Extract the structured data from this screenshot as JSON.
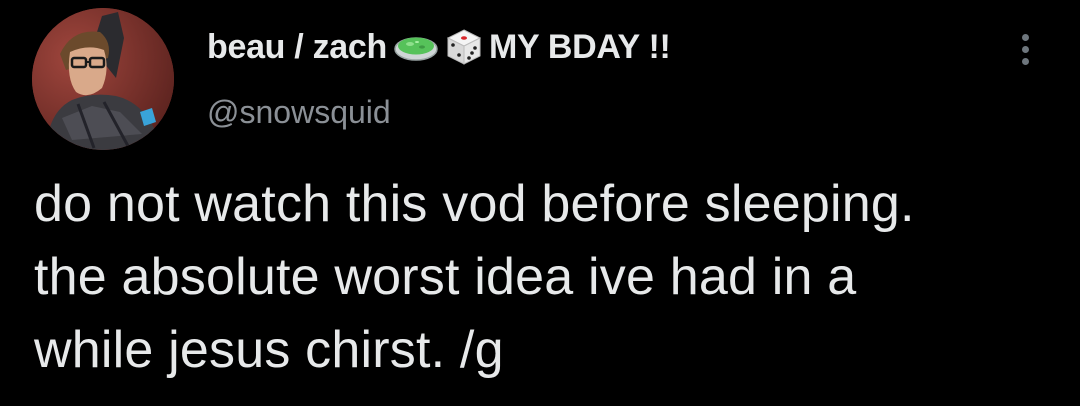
{
  "tweet": {
    "display_name": "beau / zach",
    "name_suffix": "MY BDAY !!",
    "name_emojis": [
      "petri-dish-icon",
      "dice-icon"
    ],
    "handle": "@snowsquid",
    "text": "do not watch this vod before sleeping.\nthe absolute worst idea ive had in a\nwhile jesus chirst. /g"
  },
  "colors": {
    "background": "#000000",
    "primary_text": "#e7e9ea",
    "secondary_text": "#8b9096",
    "menu_dots": "#6e767d"
  }
}
